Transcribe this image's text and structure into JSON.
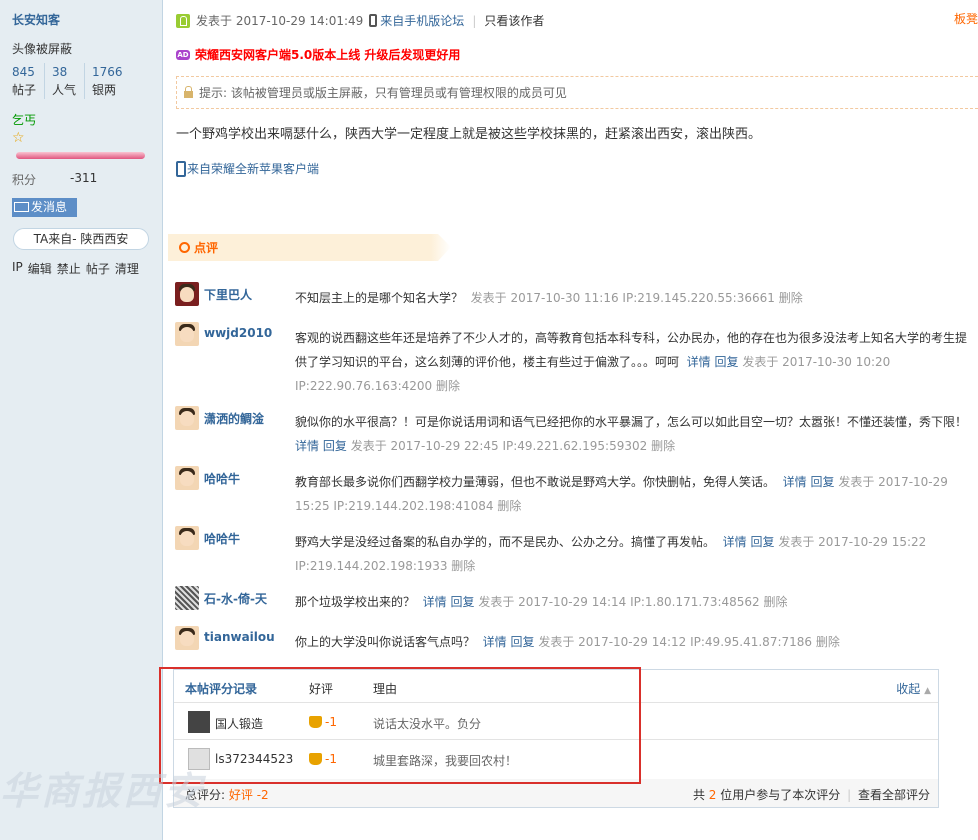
{
  "sidebar": {
    "username": "长安知客",
    "avatar_note": "头像被屏蔽",
    "stats": [
      {
        "value": "845",
        "label": "帖子"
      },
      {
        "value": "38",
        "label": "人气"
      },
      {
        "value": "1766",
        "label": "银两"
      }
    ],
    "rank": "乞丐",
    "score_label": "积分",
    "score_value": "-311",
    "message_button": "发消息",
    "from": "TA来自- 陕西西安",
    "admin_links": [
      "IP",
      "编辑",
      "禁止",
      "帖子",
      "清理"
    ]
  },
  "post": {
    "posted_prefix": "发表于",
    "posted_time": "2017-10-29 14:01:49",
    "source_link": "来自手机版论坛",
    "only_author": "只看该作者",
    "floor_link": "板凳",
    "ad_text": "荣耀西安网客户端5.0版本上线 升级后发现更好用",
    "notice": "提示: 该帖被管理员或版主屏蔽，只有管理员或有管理权限的成员可见",
    "content": "一个野鸡学校出来嗝瑟什么，陕西大学一定程度上就是被这些学校抹黑的，赶紧滚出西安，滚出陕西。",
    "client_link": "来自荣耀全新苹果客户端"
  },
  "comments_header": "点评",
  "comments": [
    {
      "name": "下里巴人",
      "text": "不知层主上的是哪个知名大学？",
      "actions": [],
      "meta": "发表于 2017-10-30 11:16 IP:219.145.220.55:36661",
      "delete": "删除"
    },
    {
      "name": "wwjd2010",
      "text": "客观的说西翻这些年还是培养了不少人才的，高等教育包括本科专科，公办民办，他的存在也为很多没法考上知名大学的考生提供了学习知识的平台，这么刻薄的评价他，楼主有些过于偏激了。。。呵呵",
      "actions": [
        "详情",
        "回复"
      ],
      "meta": "发表于 2017-10-30 10:20 IP:222.90.76.163:4200",
      "delete": "删除"
    },
    {
      "name": "潇洒的鲷淦",
      "text": "貌似你的水平很高？！可是你说话用词和语气已经把你的水平暴漏了，怎么可以如此目空一切？太嚣张！不懂还装懂，秀下限！",
      "actions": [
        "详情",
        "回复"
      ],
      "meta": "发表于 2017-10-29 22:45 IP:49.221.62.195:59302",
      "delete": "删除"
    },
    {
      "name": "哈哈牛",
      "text": "教育部长最多说你们西翻学校力量薄弱，但也不敢说是野鸡大学。你快删帖，免得人笑话。",
      "actions": [
        "详情",
        "回复"
      ],
      "meta": "发表于 2017-10-29 15:25 IP:219.144.202.198:41084",
      "delete": "删除"
    },
    {
      "name": "哈哈牛",
      "text": "野鸡大学是没经过备案的私自办学的，而不是民办、公办之分。搞懂了再发帖。",
      "actions": [
        "详情",
        "回复"
      ],
      "meta": "发表于 2017-10-29 15:22 IP:219.144.202.198:1933",
      "delete": "删除"
    },
    {
      "name": "石-水-倚-天",
      "text": "那个垃圾学校出来的？",
      "actions": [
        "详情",
        "回复"
      ],
      "meta": "发表于 2017-10-29 14:14 IP:1.80.171.73:48562",
      "delete": "删除"
    },
    {
      "name": "tianwailou",
      "text": "你上的大学没叫你说话客气点吗？",
      "actions": [
        "详情",
        "回复"
      ],
      "meta": "发表于 2017-10-29 14:12 IP:49.95.41.87:7186",
      "delete": "删除"
    }
  ],
  "rating": {
    "title": "本帖评分记录",
    "col_good": "好评",
    "col_reason": "理由",
    "collapse": "收起",
    "rows": [
      {
        "user": "国人锻造",
        "score": "-1",
        "reason": "说话太没水平。负分"
      },
      {
        "user": "ls372344523",
        "score": "-1",
        "reason": "城里套路深，我要回农村！"
      }
    ],
    "total_label": "总评分:",
    "total_value": "好评 -2",
    "participants_prefix": "共",
    "participants_count": "2",
    "participants_suffix": "位用户参与了本次评分",
    "view_all": "查看全部评分"
  },
  "watermark": "华商报西安"
}
